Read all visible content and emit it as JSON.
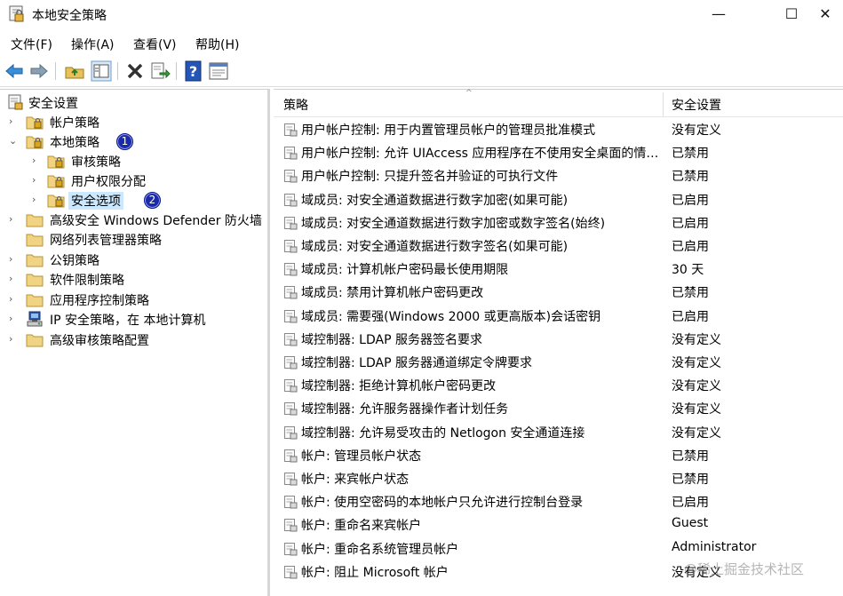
{
  "window": {
    "title": "本地安全策略",
    "min": "—",
    "max": "☐",
    "close": "✕"
  },
  "menu": [
    "文件(F)",
    "操作(A)",
    "查看(V)",
    "帮助(H)"
  ],
  "toolbar": [
    "back-icon",
    "forward-icon",
    "up-folder-icon",
    "show-tree-icon",
    "delete-icon",
    "export-icon",
    "help-icon",
    "properties-icon"
  ],
  "tree": {
    "root": "安全设置",
    "items": [
      {
        "label": "帐户策略"
      },
      {
        "label": "本地策略",
        "badge": "1"
      },
      {
        "label": "审核策略"
      },
      {
        "label": "用户权限分配"
      },
      {
        "label": "安全选项",
        "badge": "2"
      },
      {
        "label": "高级安全 Windows Defender 防火墙"
      },
      {
        "label": "网络列表管理器策略"
      },
      {
        "label": "公钥策略"
      },
      {
        "label": "软件限制策略"
      },
      {
        "label": "应用程序控制策略"
      },
      {
        "label": "IP 安全策略，在 本地计算机"
      },
      {
        "label": "高级审核策略配置"
      }
    ]
  },
  "list": {
    "col_policy": "策略",
    "col_setting": "安全设置",
    "rows": [
      {
        "name": "用户帐户控制: 用于内置管理员帐户的管理员批准模式",
        "value": "没有定义"
      },
      {
        "name": "用户帐户控制: 允许 UIAccess 应用程序在不使用安全桌面的情况下提升权限",
        "value": "已禁用"
      },
      {
        "name": "用户帐户控制: 只提升签名并验证的可执行文件",
        "value": "已禁用"
      },
      {
        "name": "域成员: 对安全通道数据进行数字加密(如果可能)",
        "value": "已启用"
      },
      {
        "name": "域成员: 对安全通道数据进行数字加密或数字签名(始终)",
        "value": "已启用"
      },
      {
        "name": "域成员: 对安全通道数据进行数字签名(如果可能)",
        "value": "已启用"
      },
      {
        "name": "域成员: 计算机帐户密码最长使用期限",
        "value": "30 天"
      },
      {
        "name": "域成员: 禁用计算机帐户密码更改",
        "value": "已禁用"
      },
      {
        "name": "域成员: 需要强(Windows 2000 或更高版本)会话密钥",
        "value": "已启用"
      },
      {
        "name": "域控制器: LDAP 服务器签名要求",
        "value": "没有定义"
      },
      {
        "name": "域控制器: LDAP 服务器通道绑定令牌要求",
        "value": "没有定义"
      },
      {
        "name": "域控制器: 拒绝计算机帐户密码更改",
        "value": "没有定义"
      },
      {
        "name": "域控制器: 允许服务器操作者计划任务",
        "value": "没有定义"
      },
      {
        "name": "域控制器:  允许易受攻击的 Netlogon 安全通道连接",
        "value": "没有定义"
      },
      {
        "name": "帐户: 管理员帐户状态",
        "value": "已禁用"
      },
      {
        "name": "帐户: 来宾帐户状态",
        "value": "已禁用"
      },
      {
        "name": "帐户: 使用空密码的本地帐户只允许进行控制台登录",
        "value": "已启用"
      },
      {
        "name": "帐户: 重命名来宾帐户",
        "value": "Guest"
      },
      {
        "name": "帐户: 重命名系统管理员帐户",
        "value": "Administrator"
      },
      {
        "name": "帐户: 阻止 Microsoft 帐户",
        "value": "没有定义"
      }
    ]
  },
  "watermark": "@稀土掘金技术社区"
}
